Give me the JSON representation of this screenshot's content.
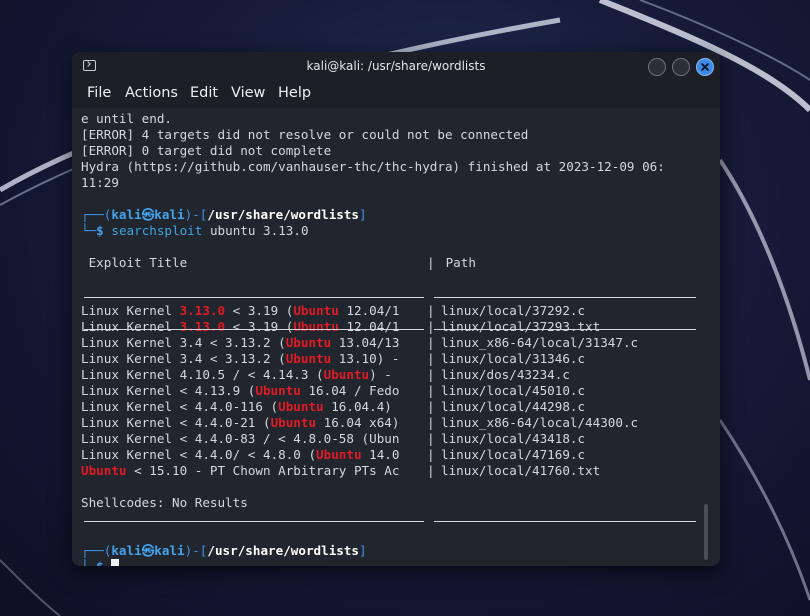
{
  "window": {
    "title": "kali@kali: /usr/share/wordlists",
    "menu": [
      "File",
      "Actions",
      "Edit",
      "View",
      "Help"
    ]
  },
  "terminal": {
    "output_before": [
      "e until end.",
      "[ERROR] 4 targets did not resolve or could not be connected",
      "[ERROR] 0 target did not complete",
      "Hydra (https://github.com/vanhauser-thc/thc-hydra) finished at 2023-12-09 06:",
      "11:29"
    ],
    "prompt": {
      "user": "kali",
      "at_symbol": "㉿",
      "host": "kali",
      "cwd": "/usr/share/wordlists",
      "dollar": "$"
    },
    "command": {
      "program": "searchsploit",
      "args": "ubuntu 3.13.0"
    },
    "table": {
      "col_title": " Exploit Title",
      "col_path": " Path",
      "rows": [
        {
          "title": [
            [
              "Linux Kernel ",
              false
            ],
            [
              "3.13.0",
              true
            ],
            [
              " < 3.19 (",
              false
            ],
            [
              "Ubuntu",
              true
            ],
            [
              " 12.04/1",
              false
            ]
          ],
          "path": "linux/local/37292.c"
        },
        {
          "title": [
            [
              "Linux Kernel ",
              false
            ],
            [
              "3.13.0",
              true
            ],
            [
              " < 3.19 (",
              false
            ],
            [
              "Ubuntu",
              true
            ],
            [
              " 12.04/1",
              false
            ]
          ],
          "path": "linux/local/37293.txt"
        },
        {
          "title": [
            [
              "Linux Kernel 3.4 < 3.13.2 (",
              false
            ],
            [
              "Ubuntu",
              true
            ],
            [
              " 13.04/13",
              false
            ]
          ],
          "path": "linux_x86-64/local/31347.c"
        },
        {
          "title": [
            [
              "Linux Kernel 3.4 < 3.13.2 (",
              false
            ],
            [
              "Ubuntu",
              true
            ],
            [
              " 13.10) -",
              false
            ]
          ],
          "path": "linux/local/31346.c"
        },
        {
          "title": [
            [
              "Linux Kernel 4.10.5 / < 4.14.3 (",
              false
            ],
            [
              "Ubuntu",
              true
            ],
            [
              ") - ",
              false
            ]
          ],
          "path": "linux/dos/43234.c"
        },
        {
          "title": [
            [
              "Linux Kernel < 4.13.9 (",
              false
            ],
            [
              "Ubuntu",
              true
            ],
            [
              " 16.04 / Fedo",
              false
            ]
          ],
          "path": "linux/local/45010.c"
        },
        {
          "title": [
            [
              "Linux Kernel < 4.4.0-116 (",
              false
            ],
            [
              "Ubuntu",
              true
            ],
            [
              " 16.04.4) ",
              false
            ]
          ],
          "path": "linux/local/44298.c"
        },
        {
          "title": [
            [
              "Linux Kernel < 4.4.0-21 (",
              false
            ],
            [
              "Ubuntu",
              true
            ],
            [
              " 16.04 x64)",
              false
            ]
          ],
          "path": "linux_x86-64/local/44300.c"
        },
        {
          "title": [
            [
              "Linux Kernel < 4.4.0-83 / < 4.8.0-58 (Ubun",
              false
            ]
          ],
          "path": "linux/local/43418.c"
        },
        {
          "title": [
            [
              "Linux Kernel < 4.4.0/ < 4.8.0 (",
              false
            ],
            [
              "Ubuntu",
              true
            ],
            [
              " 14.0",
              false
            ]
          ],
          "path": "linux/local/47169.c"
        },
        {
          "title": [
            [
              "Ubuntu",
              true
            ],
            [
              " < 15.10 - PT Chown Arbitrary PTs Ac",
              false
            ]
          ],
          "path": "linux/local/41760.txt"
        }
      ]
    },
    "shellcodes": "Shellcodes: No Results"
  },
  "colors": {
    "highlight_red": "#e01b24",
    "prompt_blue": "#3d8fe8",
    "close_button": "#3d8be6",
    "terminal_bg": "#21252e"
  }
}
